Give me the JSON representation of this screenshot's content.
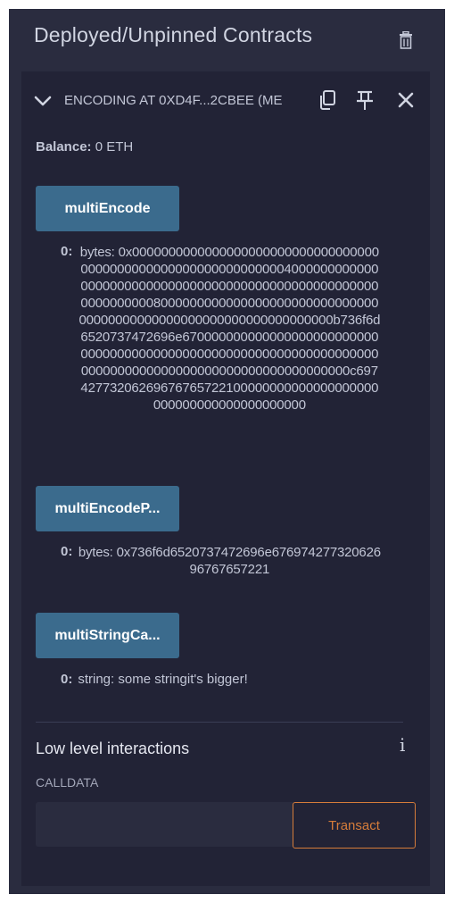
{
  "panel": {
    "title": "Deployed/Unpinned Contracts",
    "trash_icon": "trash-icon"
  },
  "contract": {
    "title": "ENCODING AT 0XD4F...2CBEE (ME",
    "icons": [
      "chevron-down-icon",
      "copy-icon",
      "pin-icon",
      "close-icon"
    ],
    "balance_label": "Balance:",
    "balance_value": "0 ETH"
  },
  "functions": [
    {
      "label": "multiEncode",
      "output_index": "0:",
      "output_value": "bytes: 0x000000000000000000000000000000000000000000000000000000000000004000000000000000000000000000000000000000000000000000000000000000800000000000000000000000000000000000000000000000000000000000000000b736f6d6520737472696e670000000000000000000000000000000000000000000000000000000000000000000000000000000000000000000000000000000c69742773206269676765722100000000000000000000000000000000000000000"
    },
    {
      "label": "multiEncodeP...",
      "output_index": "0:",
      "output_value": "bytes: 0x736f6d6520737472696e67697427732062696767657221"
    },
    {
      "label": "multiStringCa...",
      "output_index": "0:",
      "output_value": "string: some stringit's bigger!"
    }
  ],
  "low_level": {
    "title": "Low level interactions",
    "info_icon": "info-icon",
    "calldata_label": "CALLDATA",
    "calldata_value": "",
    "transact_label": "Transact"
  },
  "colors": {
    "panel_bg": "#2a2c3f",
    "card_bg": "#222336",
    "button_bg": "#3b6b8d",
    "accent_orange": "#d57c3a",
    "text": "#c2c6d6"
  }
}
